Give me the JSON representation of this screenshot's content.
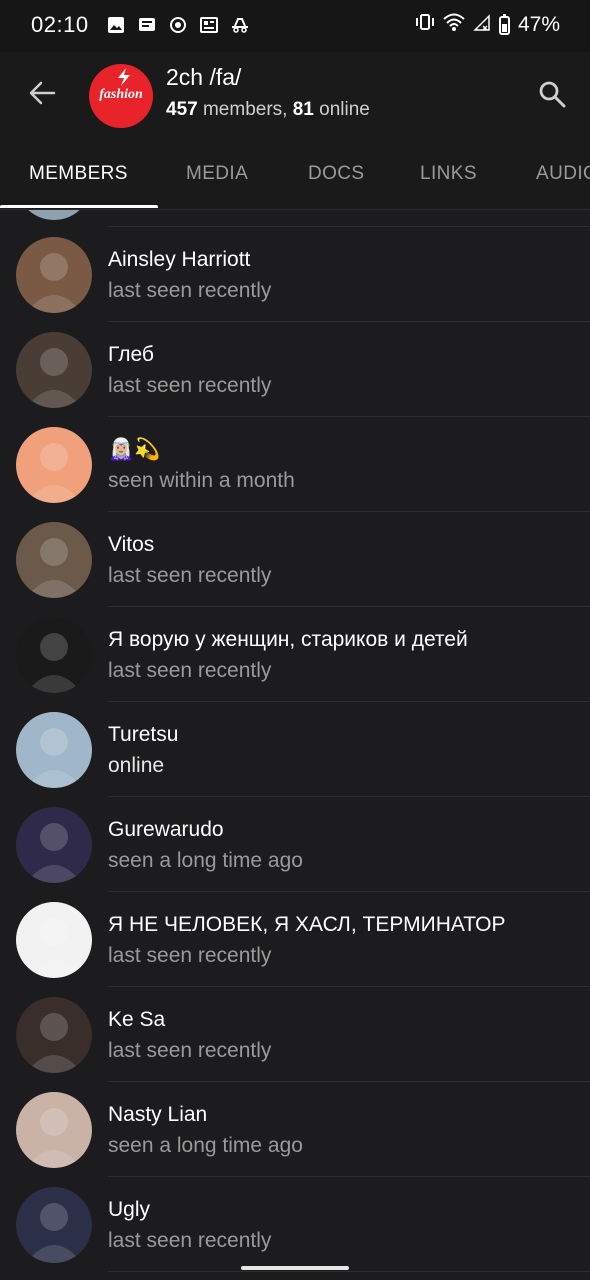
{
  "status_bar": {
    "time": "02:10",
    "battery": "47%",
    "battery_level": 0.47,
    "left_icons": [
      "gallery-icon",
      "message-icon",
      "app-icon",
      "news-icon",
      "incognito-icon"
    ],
    "right_icons": [
      "vibrate-icon",
      "wifi-icon",
      "signal-icon",
      "battery-icon"
    ]
  },
  "header": {
    "title": "2ch /fa/",
    "avatar_text": "fashion",
    "members_count": "457",
    "members_label": "members,",
    "online_count": "81",
    "online_label": "online",
    "accent": "#e8232a"
  },
  "tabs": [
    {
      "label": "MEMBERS",
      "active": true
    },
    {
      "label": "MEDIA",
      "active": false
    },
    {
      "label": "DOCS",
      "active": false
    },
    {
      "label": "LINKS",
      "active": false
    },
    {
      "label": "AUDIO",
      "active": false
    }
  ],
  "members": [
    {
      "name": "Ainsley Harriott",
      "status": "last seen recently",
      "avatar_color": "#7a5a44"
    },
    {
      "name": "Глеб",
      "status": "last seen recently",
      "avatar_color": "#4a3d35"
    },
    {
      "name": "🧝🏼‍♀️💫",
      "status": "seen within a month",
      "avatar_color": "#f0a07a",
      "avatar_emoji": "🧝"
    },
    {
      "name": "Vitos",
      "status": "last seen recently",
      "avatar_color": "#6b5a4a"
    },
    {
      "name": "Я ворую у женщин, стариков и детей",
      "status": "last seen recently",
      "avatar_color": "#1a1a1a"
    },
    {
      "name": "Turetsu",
      "status": "online",
      "avatar_color": "#9fb7c8"
    },
    {
      "name": "Gurewarudo",
      "status": "seen a long time ago",
      "avatar_color": "#2f2a4a"
    },
    {
      "name": "Я НЕ ЧЕЛОВЕК, Я ХАСЛ, ТЕРМИНАТОР",
      "status": "last seen recently",
      "avatar_color": "#f2f2f2"
    },
    {
      "name": "Ke Sa",
      "status": "last seen recently",
      "avatar_color": "#3a2e2a"
    },
    {
      "name": "Nasty Lian",
      "status": "seen a long time ago",
      "avatar_color": "#c9b2a6"
    },
    {
      "name": "Ugly",
      "status": "last seen recently",
      "avatar_color": "#2b2f48"
    }
  ]
}
